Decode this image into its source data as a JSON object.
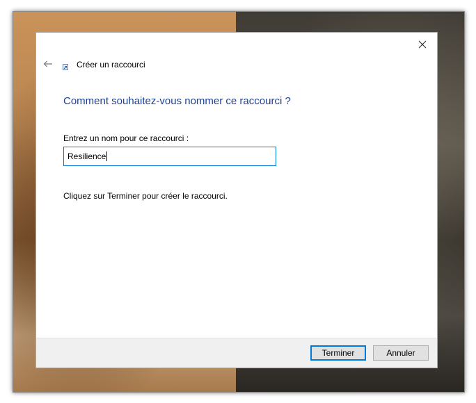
{
  "window": {
    "close_icon": "close-icon",
    "back_icon": "back-arrow-icon",
    "wizard_icon": "shortcut-icon",
    "title": "Créer un raccourci"
  },
  "content": {
    "heading": "Comment souhaitez-vous nommer ce raccourci ?",
    "name_label": "Entrez un nom pour ce raccourci :",
    "name_value": "Resilience",
    "instruction": "Cliquez sur Terminer pour créer le raccourci."
  },
  "footer": {
    "finish_label": "Terminer",
    "cancel_label": "Annuler"
  },
  "colors": {
    "heading": "#1c3f94",
    "focus_accent": "#0078d7",
    "footer_bg": "#f0f0f0"
  }
}
